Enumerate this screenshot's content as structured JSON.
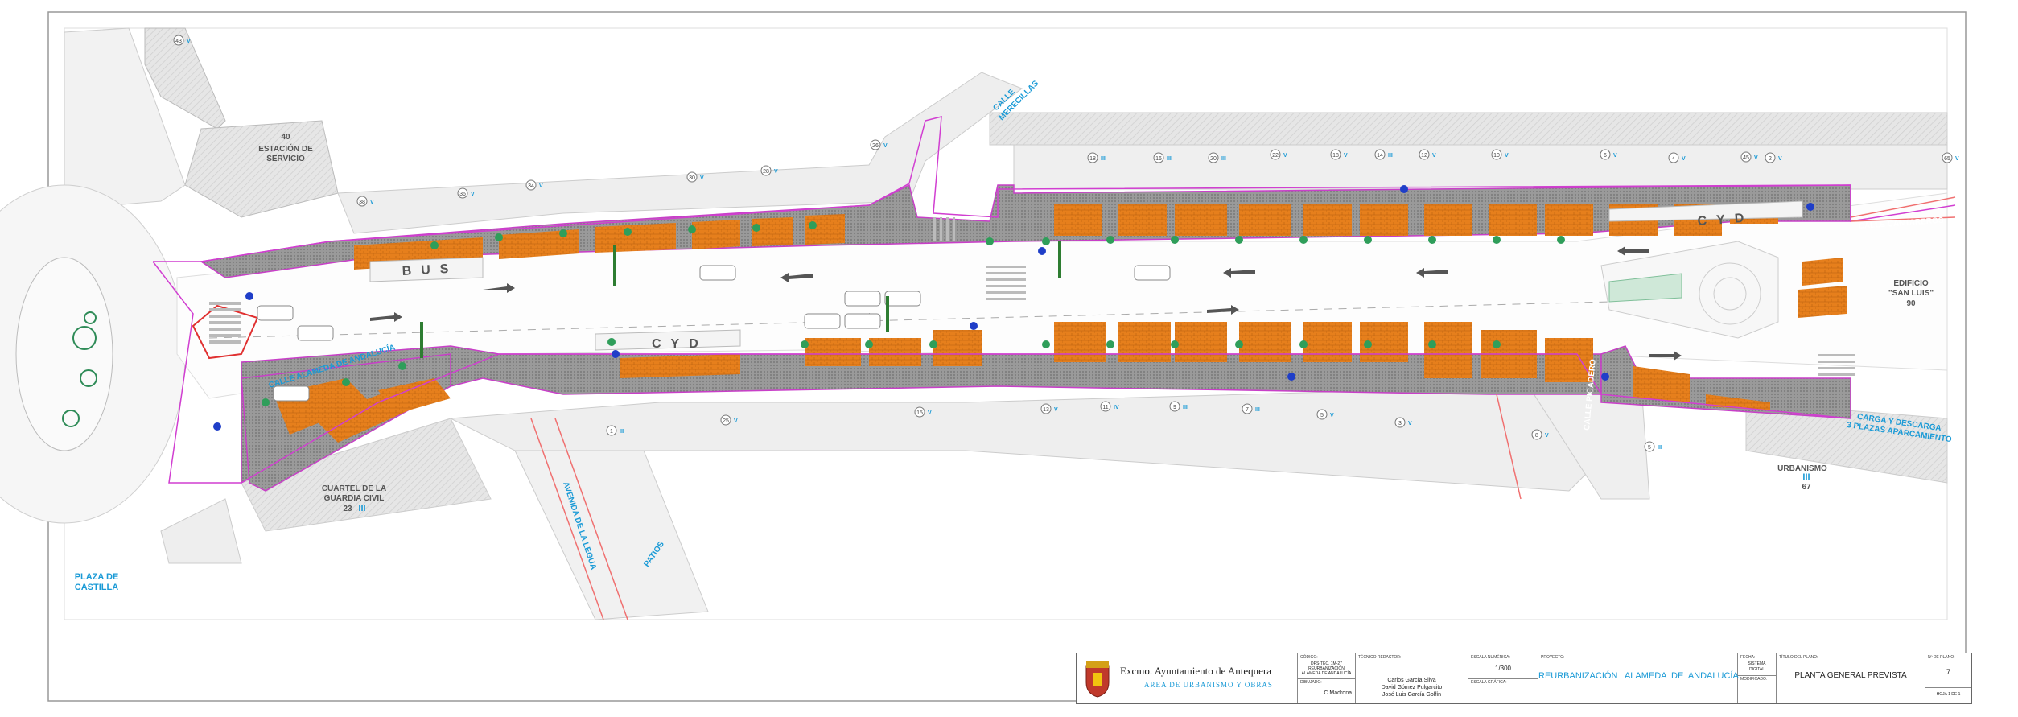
{
  "map": {
    "places": {
      "estacion_num": "40",
      "estacion": [
        "ESTACIÓN DE",
        "SERVICIO"
      ],
      "cuartel": [
        "CUARTEL DE LA",
        "GUARDIA CIVIL"
      ],
      "cuartel_num": "23",
      "cuartel_floors": "III",
      "plaza": [
        "PLAZA DE",
        "CASTILLA"
      ],
      "edificio": [
        "EDIFICIO",
        "\"SAN LUIS\""
      ],
      "edificio_num": "90",
      "urbanismo": "URBANISMO",
      "urbanismo_floors": "III",
      "urbanismo_num": "67",
      "carga": [
        "CARGA Y DESCARGA",
        "3 PLAZAS APARCAMIENTO"
      ]
    },
    "streets": {
      "mereceillas": [
        "CALLE",
        "MERECILLAS"
      ],
      "cantareros": "CALLE   CANTAREROS",
      "alameda": "CALLE ALAMEDA DE ANDALUCÍA",
      "legua": "AVENIDA DE LA LEGUA",
      "picadero": "CALLE PICADERO",
      "patios": "PATIOS"
    },
    "lane_marks": {
      "bus": "BUS",
      "cyd_top": "CYD",
      "cyd_mid": "CYD",
      "cyd_left": "CYD"
    },
    "building_tags": [
      {
        "n": "43",
        "f": "V"
      },
      {
        "n": "38",
        "f": "V"
      },
      {
        "n": "36",
        "f": "V"
      },
      {
        "n": "34",
        "f": "V"
      },
      {
        "n": "30",
        "f": "V"
      },
      {
        "n": "28",
        "f": "V"
      },
      {
        "n": "26",
        "f": "V"
      },
      {
        "n": "18",
        "f": "III"
      },
      {
        "n": "16",
        "f": "III"
      },
      {
        "n": "20",
        "f": "III"
      },
      {
        "n": "22",
        "f": "V"
      },
      {
        "n": "18",
        "f": "V"
      },
      {
        "n": "14",
        "f": "III"
      },
      {
        "n": "12",
        "f": "V"
      },
      {
        "n": "10",
        "f": "V"
      },
      {
        "n": "6",
        "f": "V"
      },
      {
        "n": "4",
        "f": "V"
      },
      {
        "n": "2",
        "f": "V"
      },
      {
        "n": "25",
        "f": "V"
      },
      {
        "n": "15",
        "f": "V"
      },
      {
        "n": "13",
        "f": "V"
      },
      {
        "n": "11",
        "f": "IV"
      },
      {
        "n": "9",
        "f": "III"
      },
      {
        "n": "7",
        "f": "III"
      },
      {
        "n": "5",
        "f": "V"
      },
      {
        "n": "3",
        "f": "V"
      },
      {
        "n": "1",
        "f": "III"
      },
      {
        "n": "8",
        "f": "V"
      },
      {
        "n": "45",
        "f": "V"
      },
      {
        "n": "65",
        "f": "V"
      },
      {
        "n": "5",
        "f": "III"
      }
    ]
  },
  "title_block": {
    "entity": "Excmo. Ayuntamiento de Antequera",
    "area": "AREA DE URBANISMO Y OBRAS",
    "codigo_h": "CÓDIGO:",
    "codigo_v": [
      "DPS-TEC. 1M-27",
      "REURBANIZACIÓN",
      "ALAMEDA DE ANDALUCÍA"
    ],
    "dibujado_h": "DIBUJADO:",
    "dibujado_v": "C.Madrona",
    "tecnico_h": "TÉCNICO REDACTOR:",
    "tecnico_v": [
      "Carlos García Silva",
      "David Gómez Pulgarcito",
      "José Luis García Golfín"
    ],
    "escala_num_h": "ESCALA NUMÉRICA:",
    "escala_num_v": "1/300",
    "escala_graf_h": "ESCALA GRÁFICA:",
    "proyecto_h": "PROYECTO:",
    "proyecto_v": "REURBANIZACIÓN   ALAMEDA  DE  ANDALUCÍA",
    "fecha_h": "FECHA:",
    "fecha_v": [
      "SISTEMA",
      "DIGITAL"
    ],
    "modificado_h": "MODIFICADO:",
    "titulo_h": "TÍTULO DEL PLANO:",
    "titulo_v": "PLANTA GENERAL PREVISTA",
    "num_plano_h": "Nº DE PLANO:",
    "num_plano_v": "7",
    "hoja": "HOJA 1  DE 1"
  }
}
